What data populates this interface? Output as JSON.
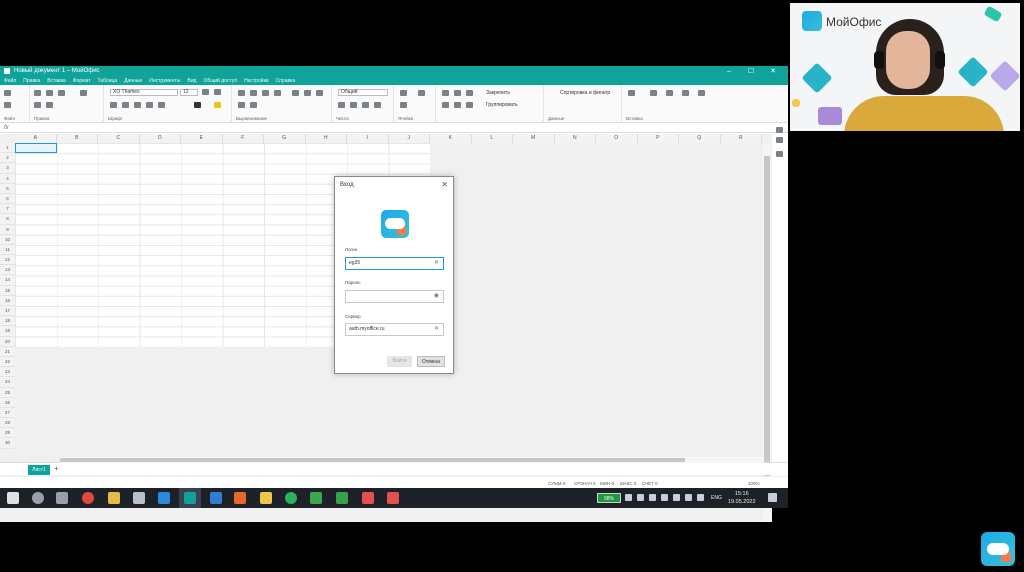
{
  "window": {
    "title": "Новый документ 1 – МойОфис",
    "controls": [
      "–",
      "☐",
      "✕"
    ]
  },
  "menu": [
    "Файл",
    "Правка",
    "Вставка",
    "Формат",
    "Таблица",
    "Данные",
    "Инструменты",
    "Вид",
    "Общий доступ",
    "Настройки",
    "Справка"
  ],
  "ribbon": {
    "groups": [
      "Файл",
      "Правка",
      "Шрифт",
      "Выравнивание",
      "Число",
      "Ячейки",
      "Данные",
      "Вставка"
    ],
    "font_name": "XO Thames",
    "font_size": "12",
    "number_format": "Общий",
    "freeze_label": "Закрепить",
    "group_label": "Группировать",
    "sort_filter_label": "Сортировка и фильтр"
  },
  "formula": {
    "fx": "fx"
  },
  "columns": [
    "A",
    "B",
    "C",
    "D",
    "E",
    "F",
    "G",
    "H",
    "I",
    "J",
    "K",
    "L",
    "M",
    "N",
    "O",
    "P",
    "Q",
    "R"
  ],
  "rows": [
    "1",
    "2",
    "3",
    "4",
    "5",
    "6",
    "7",
    "8",
    "9",
    "10",
    "11",
    "12",
    "13",
    "14",
    "15",
    "16",
    "17",
    "18",
    "19",
    "20",
    "21",
    "22",
    "23",
    "24",
    "25",
    "26",
    "27",
    "28",
    "29",
    "30"
  ],
  "sheet": {
    "tab": "Лист1",
    "add": "+"
  },
  "status": {
    "sum": "СУММ 0",
    "avg": "СРЗНАЧ 0",
    "min": "МИН 0",
    "max": "МАКС 0",
    "count": "СЧЁТ 0",
    "zoom": "100%"
  },
  "dialog": {
    "title": "Вход",
    "close": "✕",
    "login_label": "Логин",
    "login_value": "eg35",
    "password_label": "Пароль",
    "password_value": "",
    "server_label": "Сервер",
    "server_value": "auth.myoffice.ru",
    "login_button": "Войти",
    "cancel_button": "Отмена"
  },
  "taskbar": {
    "battery": "98%",
    "lang": "ENG",
    "time": "15:16",
    "date": "19.05.2022"
  },
  "webcam": {
    "brand": "МойОфис"
  },
  "colors": {
    "accent": "#0fa39a",
    "selection": "#1b9ad6",
    "logo_orange": "#f37b4f"
  }
}
